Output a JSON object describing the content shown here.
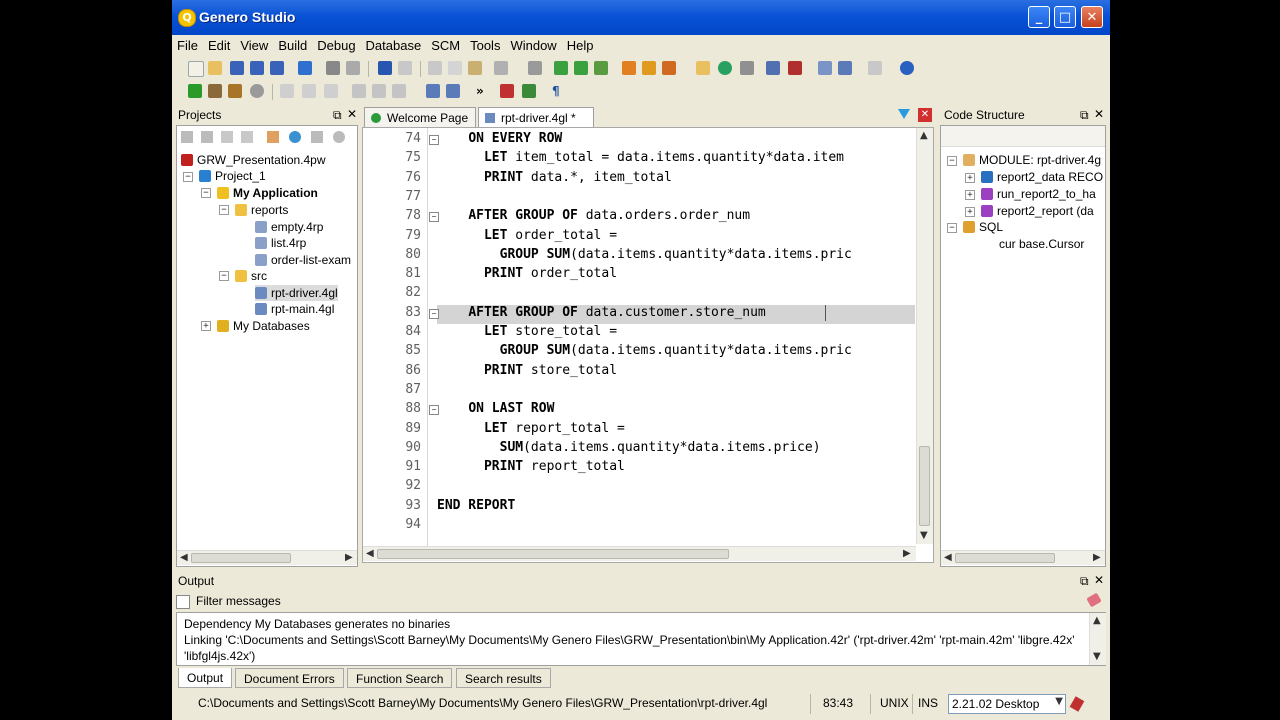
{
  "window": {
    "title": "Genero Studio",
    "minimize": "_",
    "maximize": "□",
    "close": "✕"
  },
  "menu": [
    "File",
    "Edit",
    "View",
    "Build",
    "Debug",
    "Database",
    "SCM",
    "Tools",
    "Window",
    "Help"
  ],
  "projects": {
    "title": "Projects",
    "items": [
      {
        "label": "GRW_Presentation.4pw"
      },
      {
        "label": "Project_1"
      },
      {
        "label": "My Application"
      },
      {
        "label": "reports"
      },
      {
        "label": "empty.4rp"
      },
      {
        "label": "list.4rp"
      },
      {
        "label": "order-list-exam"
      },
      {
        "label": "src"
      },
      {
        "label": "rpt-driver.4gl"
      },
      {
        "label": "rpt-main.4gl"
      },
      {
        "label": "My Databases"
      }
    ]
  },
  "editor": {
    "tabs": [
      {
        "label": "Welcome Page"
      },
      {
        "label": "rpt-driver.4gl *"
      }
    ],
    "lines": [
      {
        "n": "74",
        "kw": "ON EVERY ROW",
        "rest": ""
      },
      {
        "n": "75",
        "kw": "  LET",
        "rest": " item_total = data.items.quantity*data.item"
      },
      {
        "n": "76",
        "kw": "  PRINT",
        "rest": " data.*, item_total"
      },
      {
        "n": "77",
        "kw": "",
        "rest": ""
      },
      {
        "n": "78",
        "kw": "AFTER GROUP OF",
        "rest": " data.orders.order_num"
      },
      {
        "n": "79",
        "kw": "  LET",
        "rest": " order_total ="
      },
      {
        "n": "80",
        "kw": "    GROUP SUM",
        "rest": "(data.items.quantity*data.items.pric"
      },
      {
        "n": "81",
        "kw": "  PRINT",
        "rest": " order_total"
      },
      {
        "n": "82",
        "kw": "",
        "rest": ""
      },
      {
        "n": "83",
        "kw": "AFTER GROUP OF",
        "rest": " data.customer.store_num"
      },
      {
        "n": "84",
        "kw": "  LET",
        "rest": " store_total ="
      },
      {
        "n": "85",
        "kw": "    GROUP SUM",
        "rest": "(data.items.quantity*data.items.pric"
      },
      {
        "n": "86",
        "kw": "  PRINT",
        "rest": " store_total"
      },
      {
        "n": "87",
        "kw": "",
        "rest": ""
      },
      {
        "n": "88",
        "kw": "ON LAST ROW",
        "rest": ""
      },
      {
        "n": "89",
        "kw": "  LET",
        "rest": " report_total ="
      },
      {
        "n": "90",
        "kw": "    SUM",
        "rest": "(data.items.quantity*data.items.price)"
      },
      {
        "n": "91",
        "kw": "  PRINT",
        "rest": " report_total"
      },
      {
        "n": "92",
        "kw": "",
        "rest": ""
      },
      {
        "n": "93",
        "kw": "END REPORT",
        "rest": ""
      },
      {
        "n": "94",
        "kw": "",
        "rest": ""
      }
    ]
  },
  "code_structure": {
    "title": "Code Structure",
    "items": [
      {
        "label": "MODULE: rpt-driver.4g"
      },
      {
        "label": "report2_data RECO"
      },
      {
        "label": "run_report2_to_ha"
      },
      {
        "label": "report2_report (da"
      },
      {
        "label": "SQL"
      },
      {
        "label": "cur base.Cursor"
      }
    ]
  },
  "output": {
    "title": "Output",
    "filter_label": "Filter messages",
    "lines": [
      "Dependency My Databases generates no binaries",
      "Linking 'C:\\Documents and Settings\\Scott Barney\\My Documents\\My Genero Files\\GRW_Presentation\\bin\\My Application.42r' ('rpt-driver.42m' 'rpt-main.42m' 'libgre.42x'",
      "'libfgl4js.42x')"
    ],
    "tabs": [
      "Output",
      "Document Errors",
      "Function Search",
      "Search results"
    ]
  },
  "status": {
    "path": "C:\\Documents and Settings\\Scott Barney\\My Documents\\My Genero Files\\GRW_Presentation\\rpt-driver.4gl",
    "position": "83:43",
    "eol": "UNIX",
    "mode": "INS",
    "version": "2.21.02 Desktop"
  }
}
